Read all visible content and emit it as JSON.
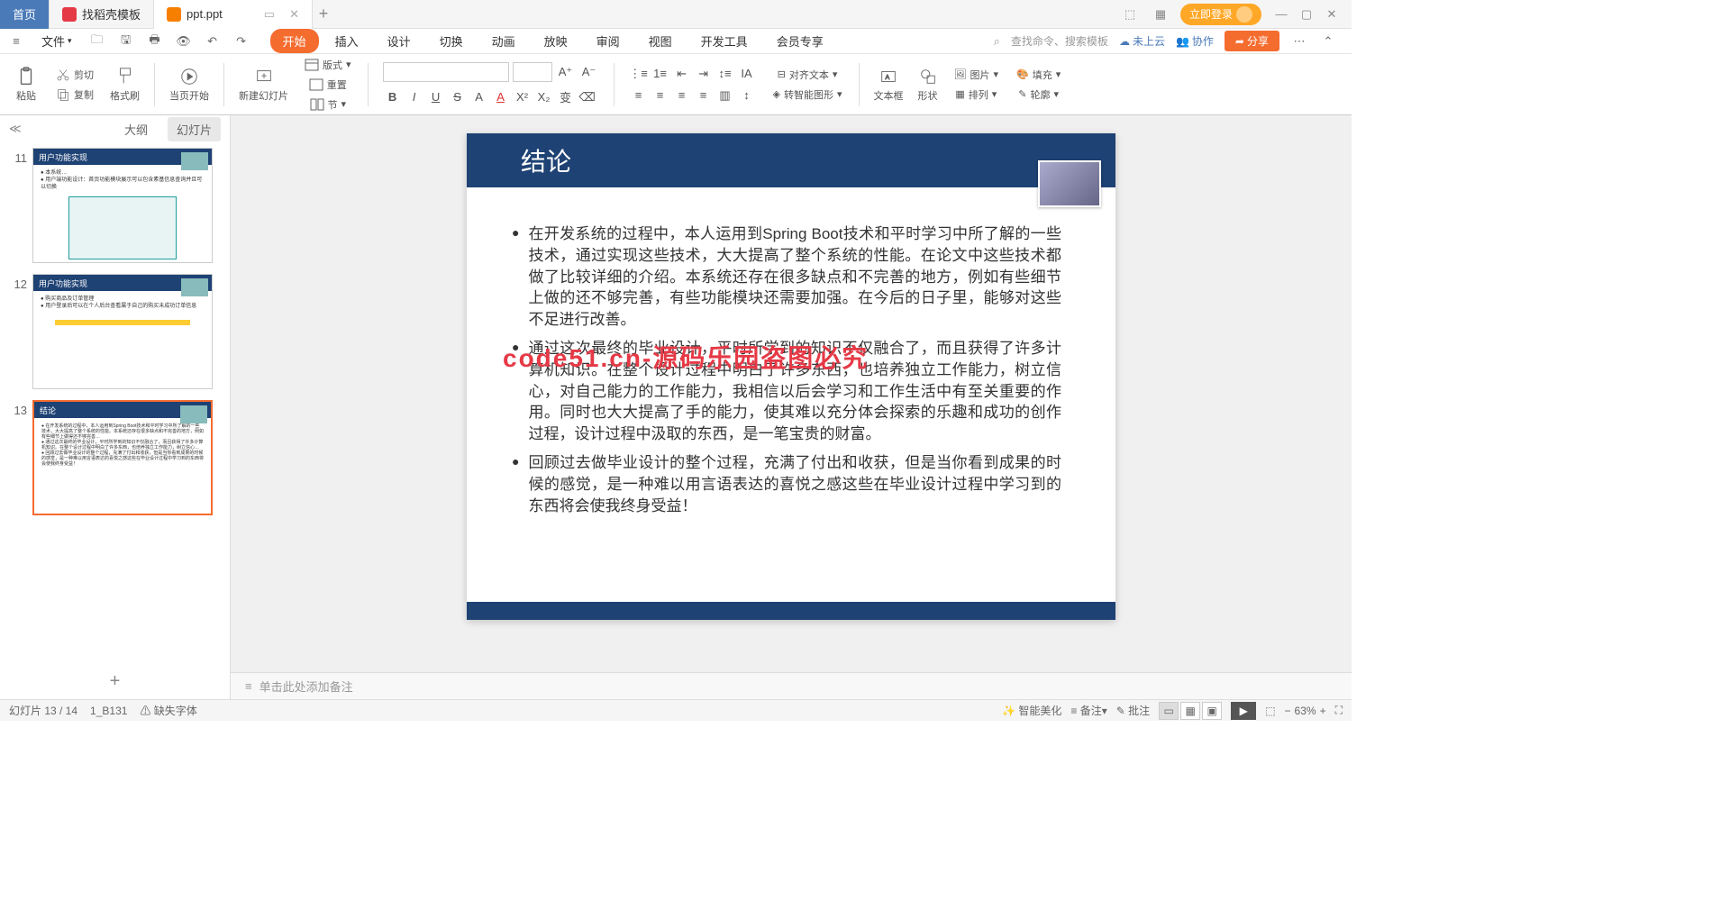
{
  "titlebar": {
    "tabs": [
      {
        "label": "首页",
        "type": "home"
      },
      {
        "label": "找稻壳模板",
        "icon": "dk"
      },
      {
        "label": "ppt.ppt",
        "icon": "ppt",
        "active": true
      }
    ],
    "login": "立即登录"
  },
  "menubar": {
    "file": "文件",
    "tabs": [
      "开始",
      "插入",
      "设计",
      "切换",
      "动画",
      "放映",
      "审阅",
      "视图",
      "开发工具",
      "会员专享"
    ],
    "active": 0,
    "search_placeholder": "查找命令、搜索模板",
    "cloud": "未上云",
    "collab": "协作",
    "share": "分享"
  },
  "ribbon": {
    "paste": "粘贴",
    "cut": "剪切",
    "copy": "复制",
    "format_painter": "格式刷",
    "from_current": "当页开始",
    "new_slide": "新建幻灯片",
    "layout": "版式",
    "reset": "重置",
    "section": "节",
    "align_text": "对齐文本",
    "smart_art": "转智能图形",
    "textbox": "文本框",
    "shapes": "形状",
    "picture": "图片",
    "arrange": "排列",
    "fill": "填充",
    "outline": "轮廓"
  },
  "sidebar": {
    "tab_outline": "大纲",
    "tab_slides": "幻灯片",
    "thumbs": [
      {
        "num": 11,
        "title": "用户功能实现"
      },
      {
        "num": 12,
        "title": "用户功能实现"
      },
      {
        "num": 13,
        "title": "结论",
        "selected": true
      }
    ]
  },
  "slide": {
    "title": "结论",
    "bullets": [
      "在开发系统的过程中，本人运用到Spring Boot技术和平时学习中所了解的一些技术，通过实现这些技术，大大提高了整个系统的性能。在论文中这些技术都做了比较详细的介绍。本系统还存在很多缺点和不完善的地方，例如有些细节上做的还不够完善，有些功能模块还需要加强。在今后的日子里，能够对这些不足进行改善。",
      "通过这次最终的毕业设计，平时所学到的知识不仅融合了，而且获得了许多计算机知识。在整个设计过程中明白了许多东西，也培养独立工作能力，树立信心，对自己能力的工作能力，我相信以后会学习和工作生活中有至关重要的作用。同时也大大提高了手的能力，使其难以充分体会探索的乐趣和成功的创作过程，设计过程中汲取的东西，是一笔宝贵的财富。",
      "回顾过去做毕业设计的整个过程，充满了付出和收获，但是当你看到成果的时候的感觉，是一种难以用言语表达的喜悦之感这些在毕业设计过程中学习到的东西将会使我终身受益！"
    ],
    "watermark": "code51.cn-源码乐园盗图必究"
  },
  "notes": "单击此处添加备注",
  "status": {
    "slide_pos": "幻灯片 13 / 14",
    "design": "1_B131",
    "missing_font": "缺失字体",
    "beautify": "智能美化",
    "notes_btn": "备注",
    "comments": "批注",
    "zoom": "63%"
  }
}
